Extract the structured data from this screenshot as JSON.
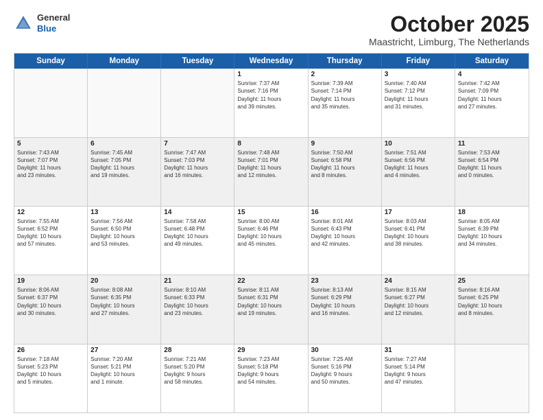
{
  "logo": {
    "general": "General",
    "blue": "Blue"
  },
  "title": "October 2025",
  "subtitle": "Maastricht, Limburg, The Netherlands",
  "header_days": [
    "Sunday",
    "Monday",
    "Tuesday",
    "Wednesday",
    "Thursday",
    "Friday",
    "Saturday"
  ],
  "weeks": [
    [
      {
        "day": "",
        "info": "",
        "empty": true
      },
      {
        "day": "",
        "info": "",
        "empty": true
      },
      {
        "day": "",
        "info": "",
        "empty": true
      },
      {
        "day": "1",
        "info": "Sunrise: 7:37 AM\nSunset: 7:16 PM\nDaylight: 11 hours\nand 39 minutes."
      },
      {
        "day": "2",
        "info": "Sunrise: 7:39 AM\nSunset: 7:14 PM\nDaylight: 11 hours\nand 35 minutes."
      },
      {
        "day": "3",
        "info": "Sunrise: 7:40 AM\nSunset: 7:12 PM\nDaylight: 11 hours\nand 31 minutes."
      },
      {
        "day": "4",
        "info": "Sunrise: 7:42 AM\nSunset: 7:09 PM\nDaylight: 11 hours\nand 27 minutes."
      }
    ],
    [
      {
        "day": "5",
        "info": "Sunrise: 7:43 AM\nSunset: 7:07 PM\nDaylight: 11 hours\nand 23 minutes."
      },
      {
        "day": "6",
        "info": "Sunrise: 7:45 AM\nSunset: 7:05 PM\nDaylight: 11 hours\nand 19 minutes."
      },
      {
        "day": "7",
        "info": "Sunrise: 7:47 AM\nSunset: 7:03 PM\nDaylight: 11 hours\nand 16 minutes."
      },
      {
        "day": "8",
        "info": "Sunrise: 7:48 AM\nSunset: 7:01 PM\nDaylight: 11 hours\nand 12 minutes."
      },
      {
        "day": "9",
        "info": "Sunrise: 7:50 AM\nSunset: 6:58 PM\nDaylight: 11 hours\nand 8 minutes."
      },
      {
        "day": "10",
        "info": "Sunrise: 7:51 AM\nSunset: 6:56 PM\nDaylight: 11 hours\nand 4 minutes."
      },
      {
        "day": "11",
        "info": "Sunrise: 7:53 AM\nSunset: 6:54 PM\nDaylight: 11 hours\nand 0 minutes."
      }
    ],
    [
      {
        "day": "12",
        "info": "Sunrise: 7:55 AM\nSunset: 6:52 PM\nDaylight: 10 hours\nand 57 minutes."
      },
      {
        "day": "13",
        "info": "Sunrise: 7:56 AM\nSunset: 6:50 PM\nDaylight: 10 hours\nand 53 minutes."
      },
      {
        "day": "14",
        "info": "Sunrise: 7:58 AM\nSunset: 6:48 PM\nDaylight: 10 hours\nand 49 minutes."
      },
      {
        "day": "15",
        "info": "Sunrise: 8:00 AM\nSunset: 6:46 PM\nDaylight: 10 hours\nand 45 minutes."
      },
      {
        "day": "16",
        "info": "Sunrise: 8:01 AM\nSunset: 6:43 PM\nDaylight: 10 hours\nand 42 minutes."
      },
      {
        "day": "17",
        "info": "Sunrise: 8:03 AM\nSunset: 6:41 PM\nDaylight: 10 hours\nand 38 minutes."
      },
      {
        "day": "18",
        "info": "Sunrise: 8:05 AM\nSunset: 6:39 PM\nDaylight: 10 hours\nand 34 minutes."
      }
    ],
    [
      {
        "day": "19",
        "info": "Sunrise: 8:06 AM\nSunset: 6:37 PM\nDaylight: 10 hours\nand 30 minutes."
      },
      {
        "day": "20",
        "info": "Sunrise: 8:08 AM\nSunset: 6:35 PM\nDaylight: 10 hours\nand 27 minutes."
      },
      {
        "day": "21",
        "info": "Sunrise: 8:10 AM\nSunset: 6:33 PM\nDaylight: 10 hours\nand 23 minutes."
      },
      {
        "day": "22",
        "info": "Sunrise: 8:11 AM\nSunset: 6:31 PM\nDaylight: 10 hours\nand 19 minutes."
      },
      {
        "day": "23",
        "info": "Sunrise: 8:13 AM\nSunset: 6:29 PM\nDaylight: 10 hours\nand 16 minutes."
      },
      {
        "day": "24",
        "info": "Sunrise: 8:15 AM\nSunset: 6:27 PM\nDaylight: 10 hours\nand 12 minutes."
      },
      {
        "day": "25",
        "info": "Sunrise: 8:16 AM\nSunset: 6:25 PM\nDaylight: 10 hours\nand 8 minutes."
      }
    ],
    [
      {
        "day": "26",
        "info": "Sunrise: 7:18 AM\nSunset: 5:23 PM\nDaylight: 10 hours\nand 5 minutes."
      },
      {
        "day": "27",
        "info": "Sunrise: 7:20 AM\nSunset: 5:21 PM\nDaylight: 10 hours\nand 1 minute."
      },
      {
        "day": "28",
        "info": "Sunrise: 7:21 AM\nSunset: 5:20 PM\nDaylight: 9 hours\nand 58 minutes."
      },
      {
        "day": "29",
        "info": "Sunrise: 7:23 AM\nSunset: 5:18 PM\nDaylight: 9 hours\nand 54 minutes."
      },
      {
        "day": "30",
        "info": "Sunrise: 7:25 AM\nSunset: 5:16 PM\nDaylight: 9 hours\nand 50 minutes."
      },
      {
        "day": "31",
        "info": "Sunrise: 7:27 AM\nSunset: 5:14 PM\nDaylight: 9 hours\nand 47 minutes."
      },
      {
        "day": "",
        "info": "",
        "empty": true
      }
    ]
  ]
}
